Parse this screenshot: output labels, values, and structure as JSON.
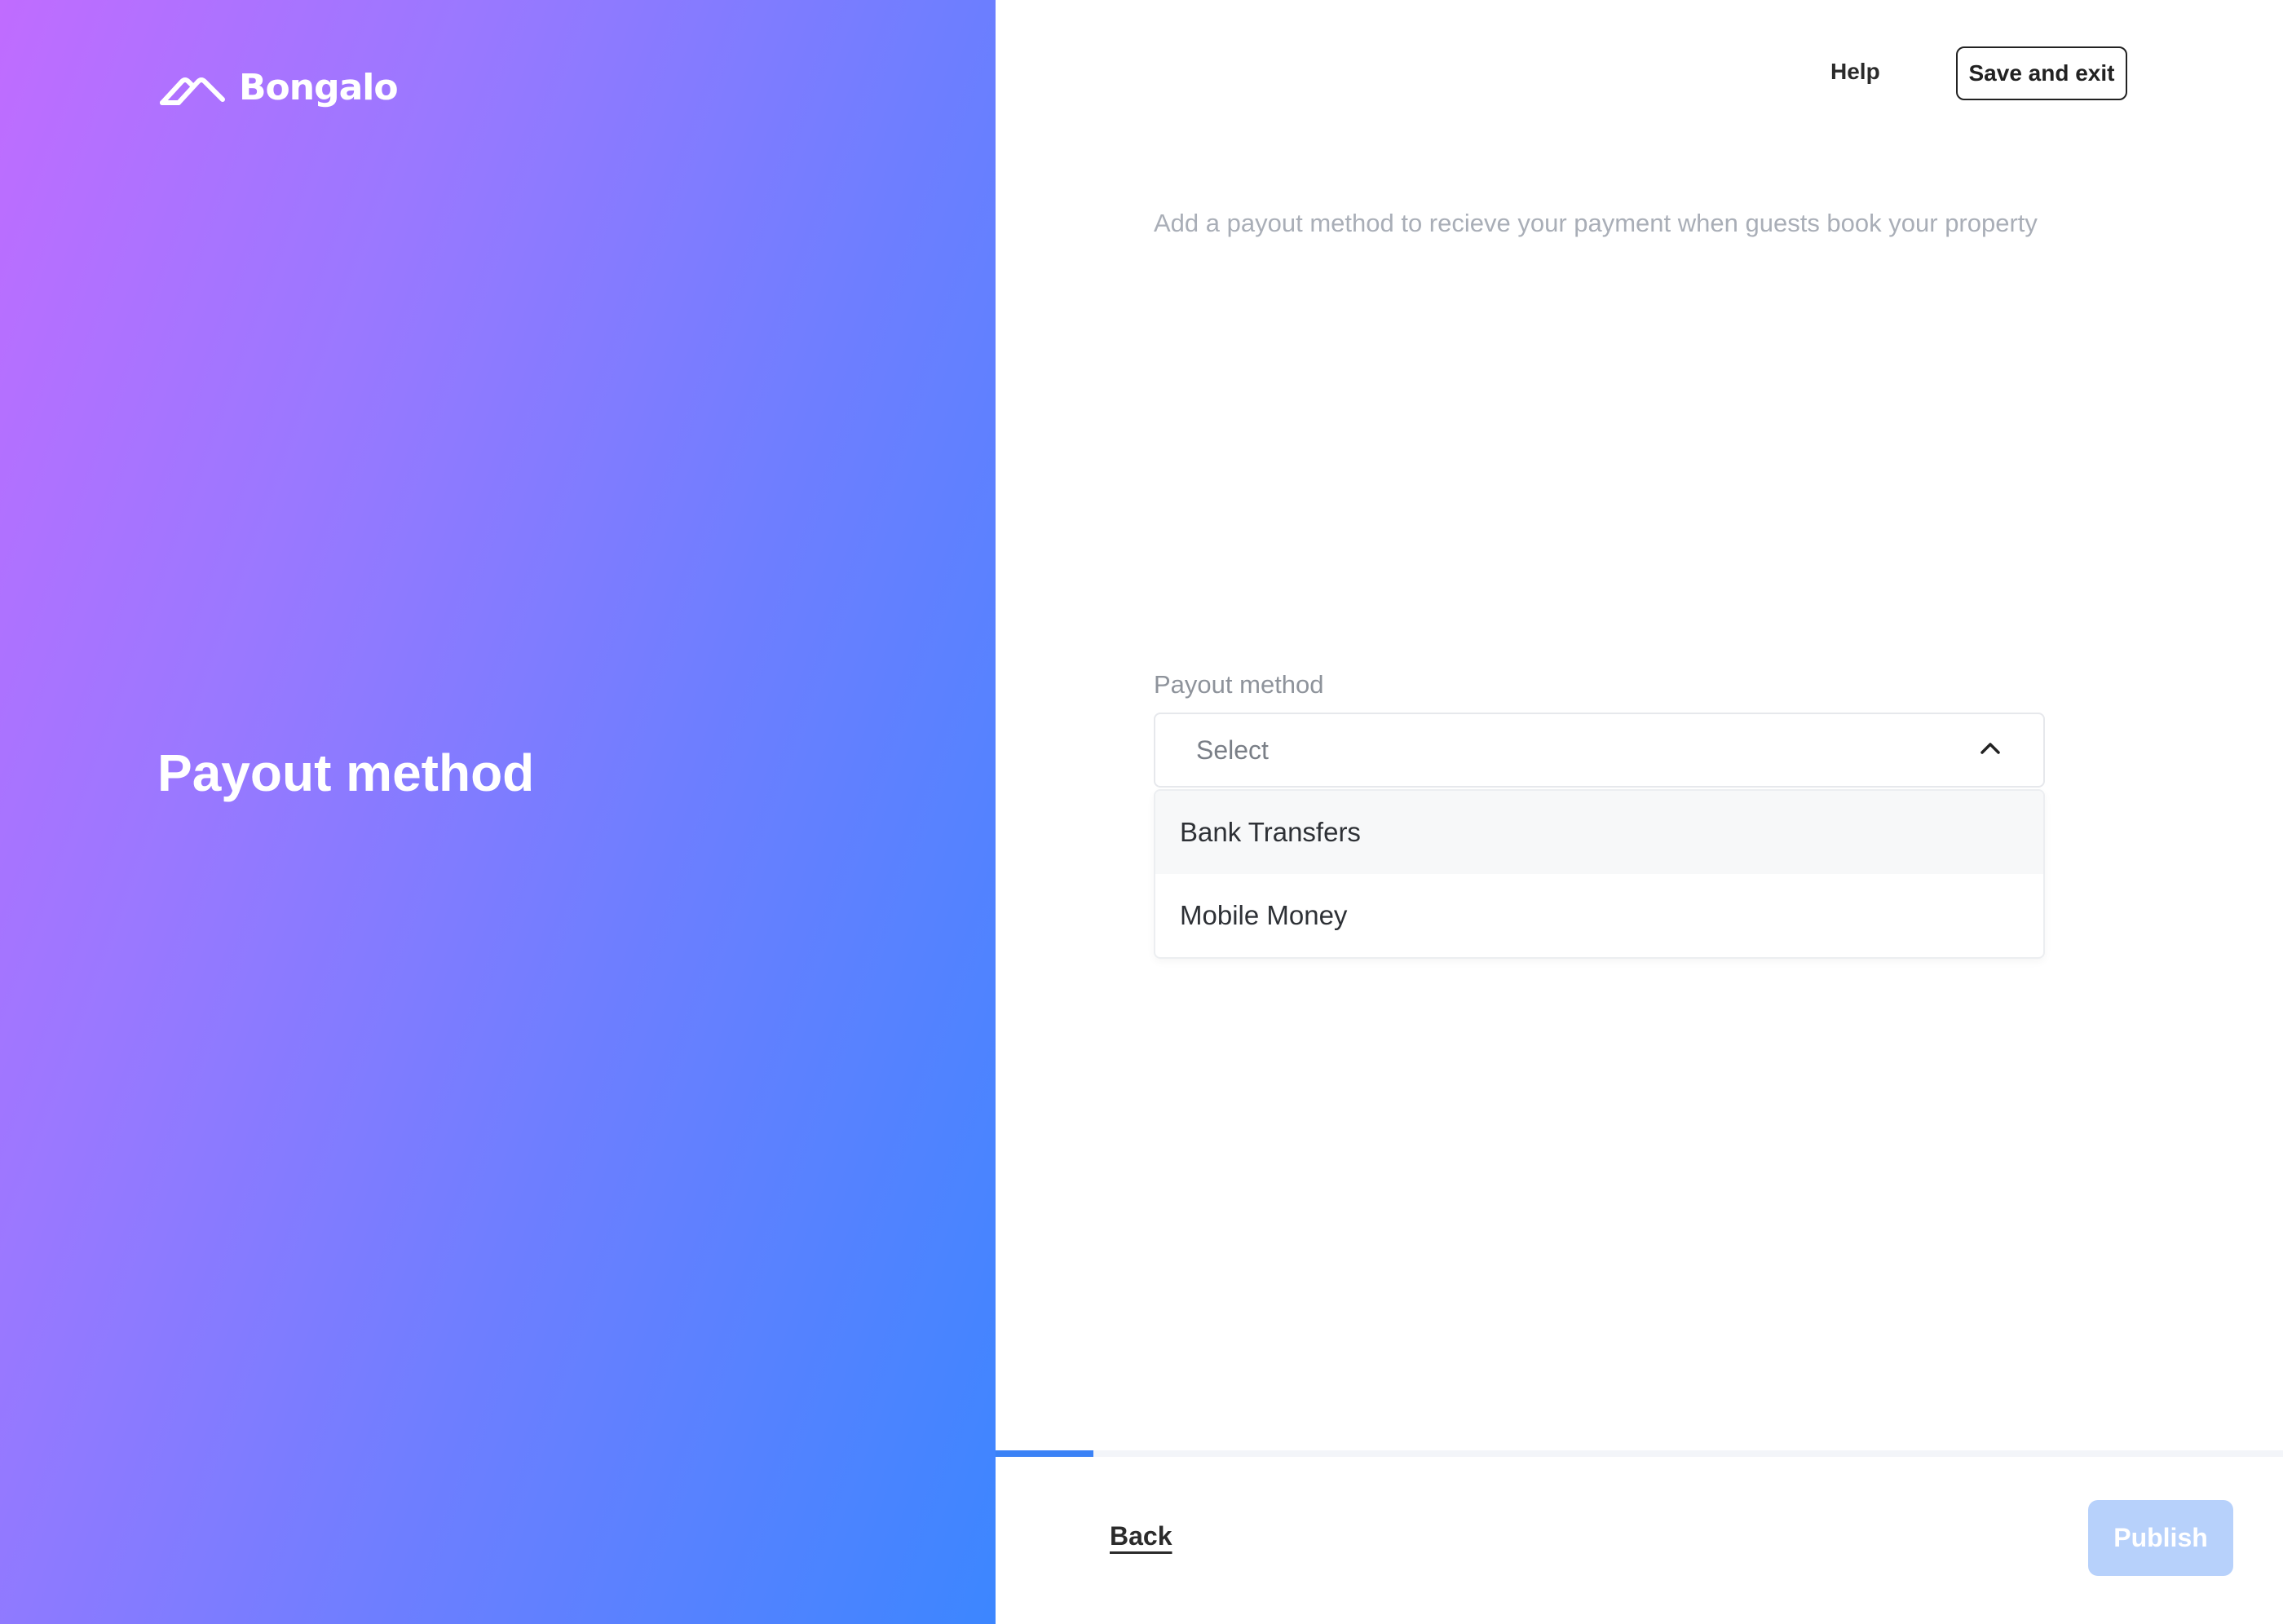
{
  "brand": {
    "name": "Bongalo",
    "logo_icon": "roof-chevron-icon"
  },
  "left_panel": {
    "title": "Payout method",
    "gradient": [
      "#c06cff",
      "#3c86ff"
    ]
  },
  "header": {
    "help_label": "Help",
    "save_exit_label": "Save and exit"
  },
  "main": {
    "subtitle": "Add a payout method to recieve your payment when guests book your property",
    "payout_field": {
      "label": "Payout method",
      "value": "Select",
      "expanded": true,
      "options": [
        {
          "label": "Bank Transfers",
          "highlighted": true
        },
        {
          "label": "Mobile Money",
          "highlighted": false
        }
      ]
    }
  },
  "footer": {
    "progress_fraction": 0.076,
    "back_label": "Back",
    "publish_label": "Publish",
    "publish_enabled": false,
    "accent_color": "#3b82f6"
  }
}
